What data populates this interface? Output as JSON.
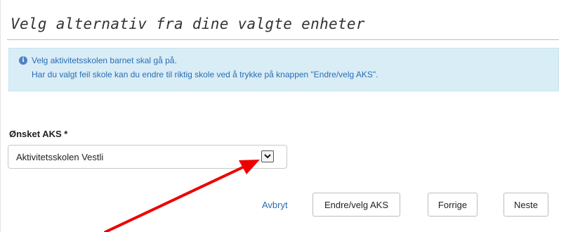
{
  "section": {
    "title": "Velg alternativ fra dine valgte enheter"
  },
  "info": {
    "icon": "info-icon",
    "line1": "Velg aktivitetsskolen barnet skal gå på.",
    "line2": "Har du valgt feil skole kan du endre til riktig skole ved å trykke på knappen \"Endre/velg AKS\"."
  },
  "form": {
    "aks_label": "Ønsket AKS *",
    "aks_selected": "Aktivitetsskolen Vestli"
  },
  "actions": {
    "cancel_label": "Avbryt",
    "change_label": "Endre/velg AKS",
    "previous_label": "Forrige",
    "next_label": "Neste"
  },
  "colors": {
    "info_background": "#d9edf7",
    "link": "#2a6cb3",
    "annotation_arrow": "#ee0000"
  }
}
